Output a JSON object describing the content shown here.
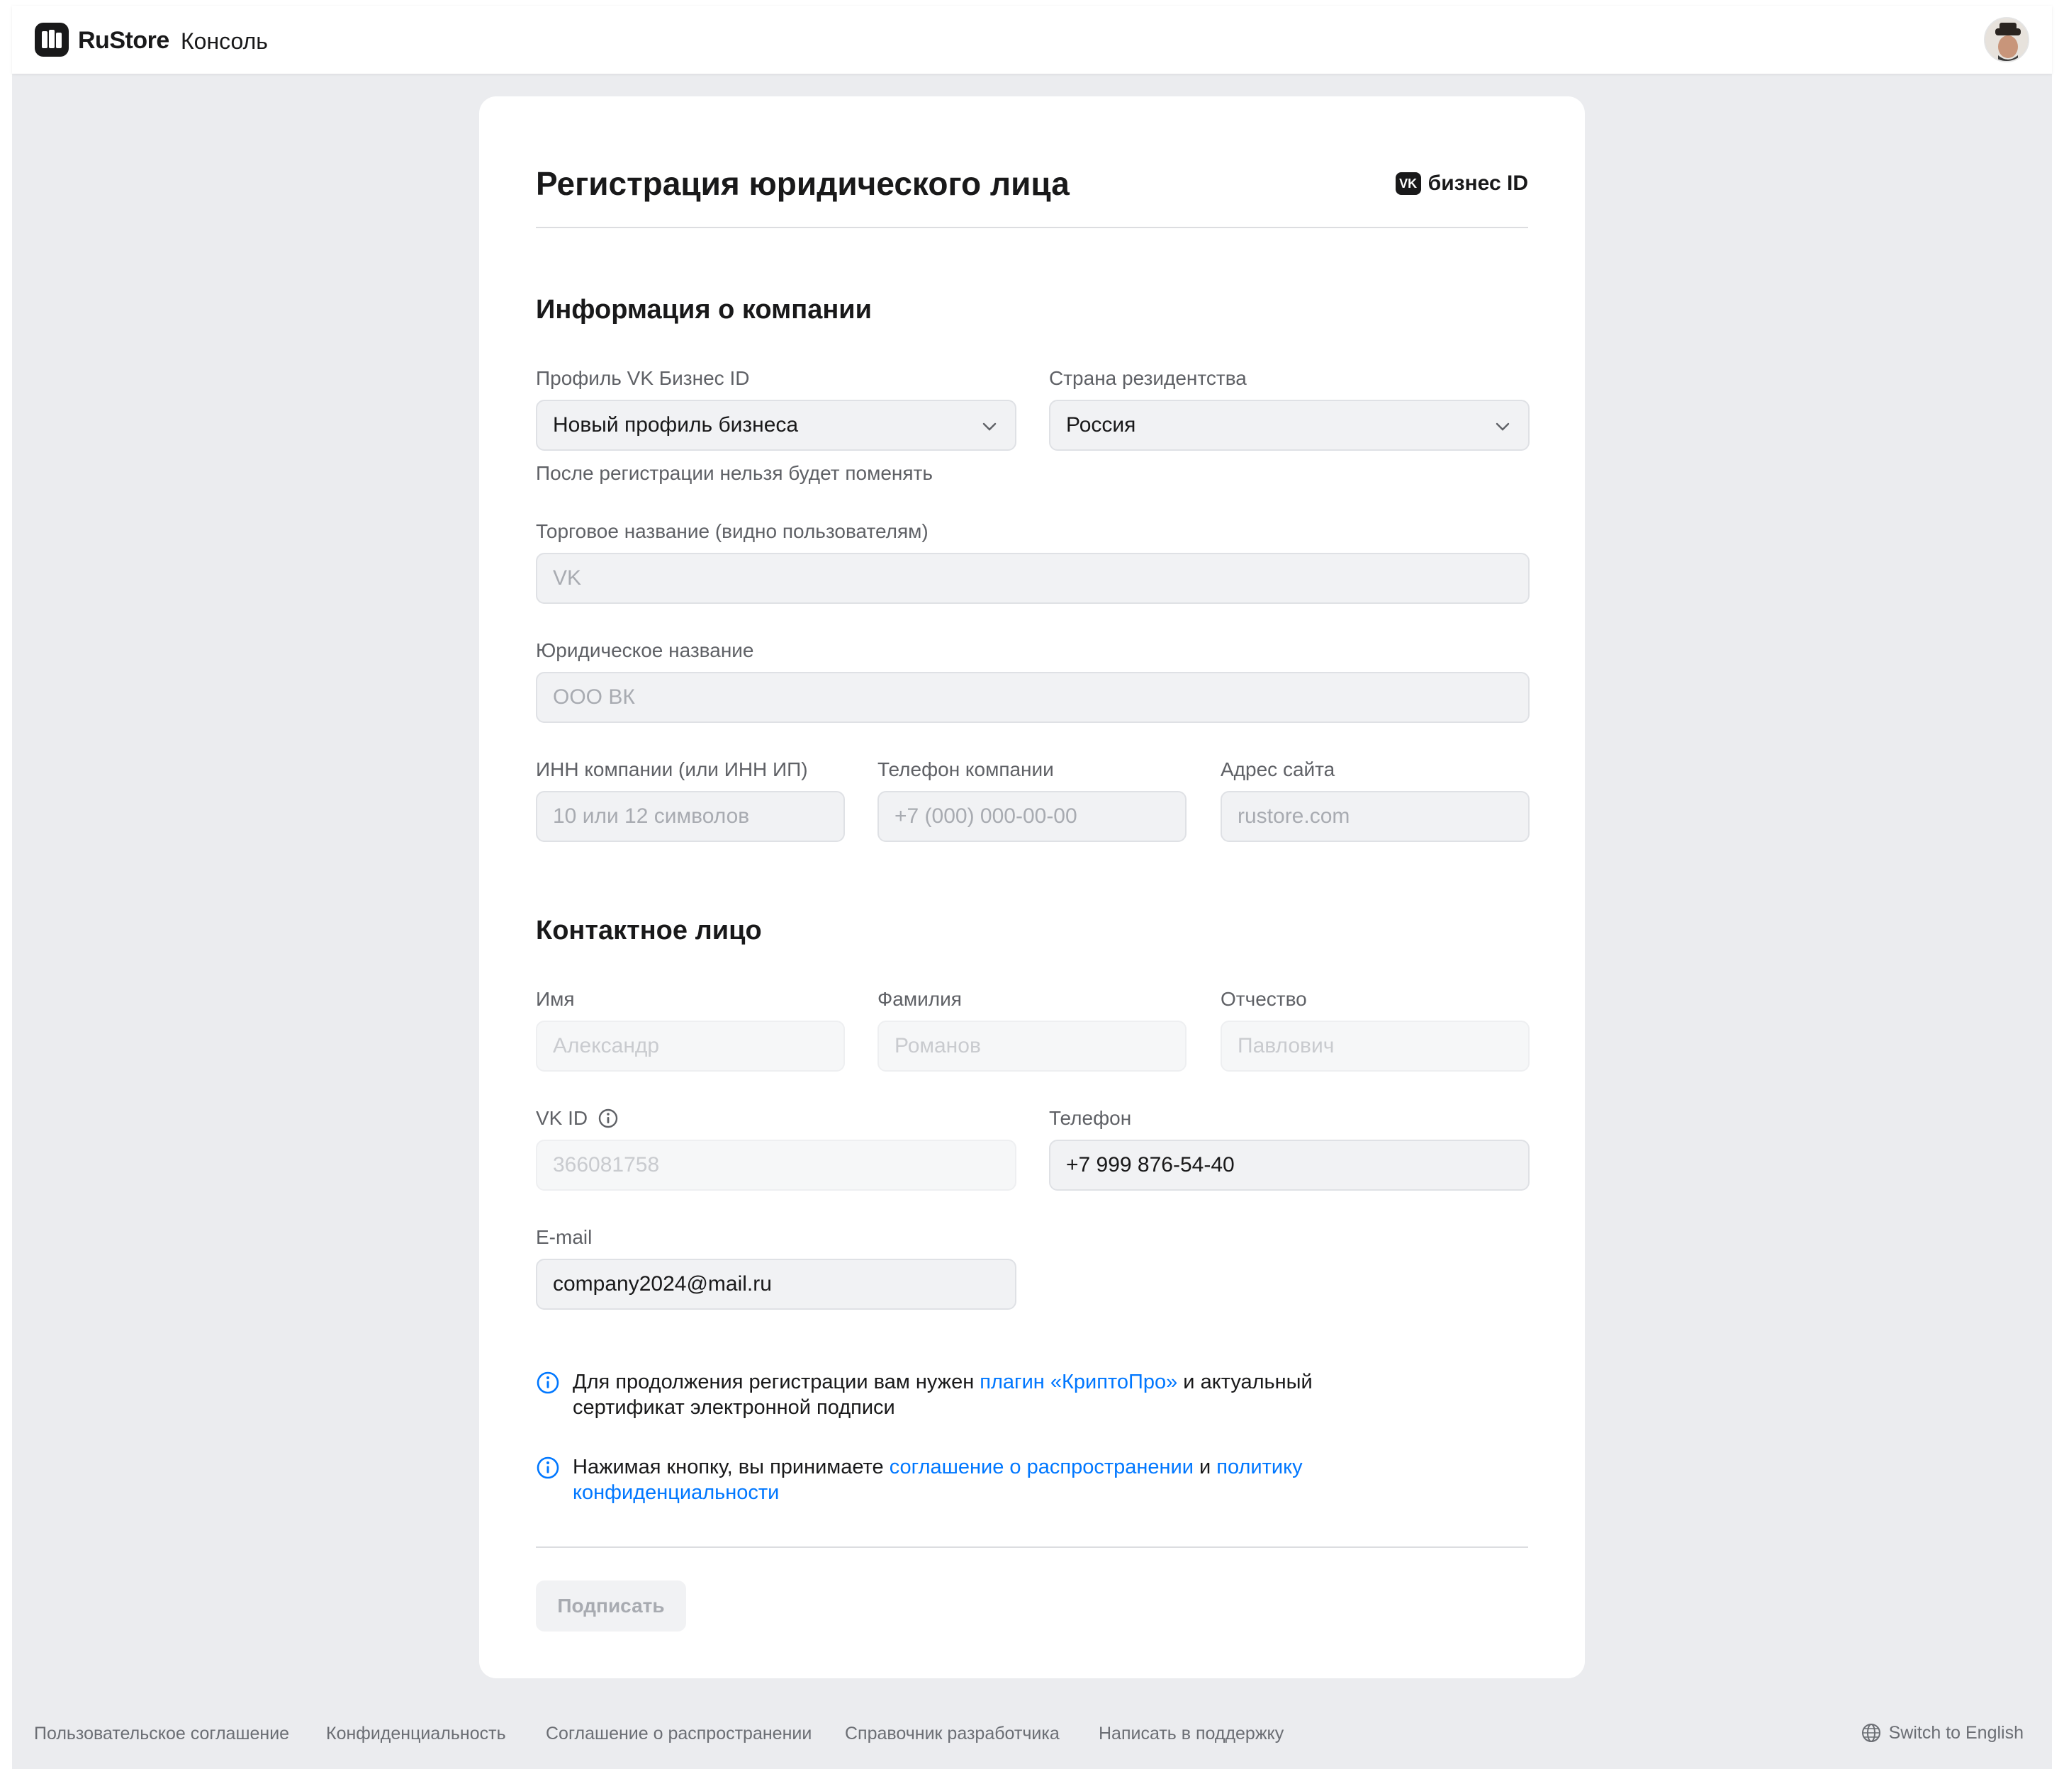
{
  "header": {
    "brand": "RuStore",
    "product": "Консоль"
  },
  "form": {
    "title": "Регистрация юридического лица",
    "business_badge": "бизнес ID",
    "company_section": {
      "title": "Информация о компании",
      "profile_label": "Профиль VK Бизнес ID",
      "profile_value": "Новый профиль бизнеса",
      "profile_hint": "После регистрации нельзя будет поменять",
      "country_label": "Страна резидентства",
      "country_value": "Россия",
      "trade_name_label": "Торговое название (видно пользователям)",
      "trade_name_placeholder": "VK",
      "legal_name_label": "Юридическое название",
      "legal_name_placeholder": "ООО ВК",
      "inn_label": "ИНН компании (или ИНН ИП)",
      "inn_placeholder": "10 или 12 символов",
      "company_phone_label": "Телефон компании",
      "company_phone_placeholder": "+7 (000) 000-00-00",
      "site_label": "Адрес сайта",
      "site_placeholder": "rustore.com"
    },
    "contact_section": {
      "title": "Контактное лицо",
      "first_name_label": "Имя",
      "first_name_placeholder": "Александр",
      "last_name_label": "Фамилия",
      "last_name_placeholder": "Романов",
      "middle_name_label": "Отчество",
      "middle_name_placeholder": "Павлович",
      "vkid_label": "VK ID",
      "vkid_value": "366081758",
      "phone_label": "Телефон",
      "phone_value": "+7 999 876-54-40",
      "email_label": "E-mail",
      "email_value": "company2024@mail.ru"
    },
    "notices": {
      "crypto_prefix": "Для продолжения регистрации вам нужен ",
      "crypto_link": "плагин «КриптоПро»",
      "crypto_suffix": " и актуальный сертификат электронной подписи",
      "agree_prefix": "Нажимая кнопку, вы принимаете ",
      "agree_link1": "соглашение о распространении",
      "agree_mid": " и ",
      "agree_link2": "политику конфиденциальности"
    },
    "submit_label": "Подписать"
  },
  "footer": {
    "links": [
      "Пользовательское соглашение",
      "Конфиденциальность",
      "Соглашение о распространении",
      "Справочник разработчика",
      "Написать в поддержку"
    ],
    "language_switch": "Switch to English"
  },
  "colors": {
    "link": "#0077ff",
    "page_bg": "#ebecef",
    "field_bg": "#f1f2f4"
  },
  "icons": [
    "rustore-logo-icon",
    "chevron-down-icon",
    "info-icon",
    "globe-icon",
    "vk-icon",
    "avatar"
  ]
}
